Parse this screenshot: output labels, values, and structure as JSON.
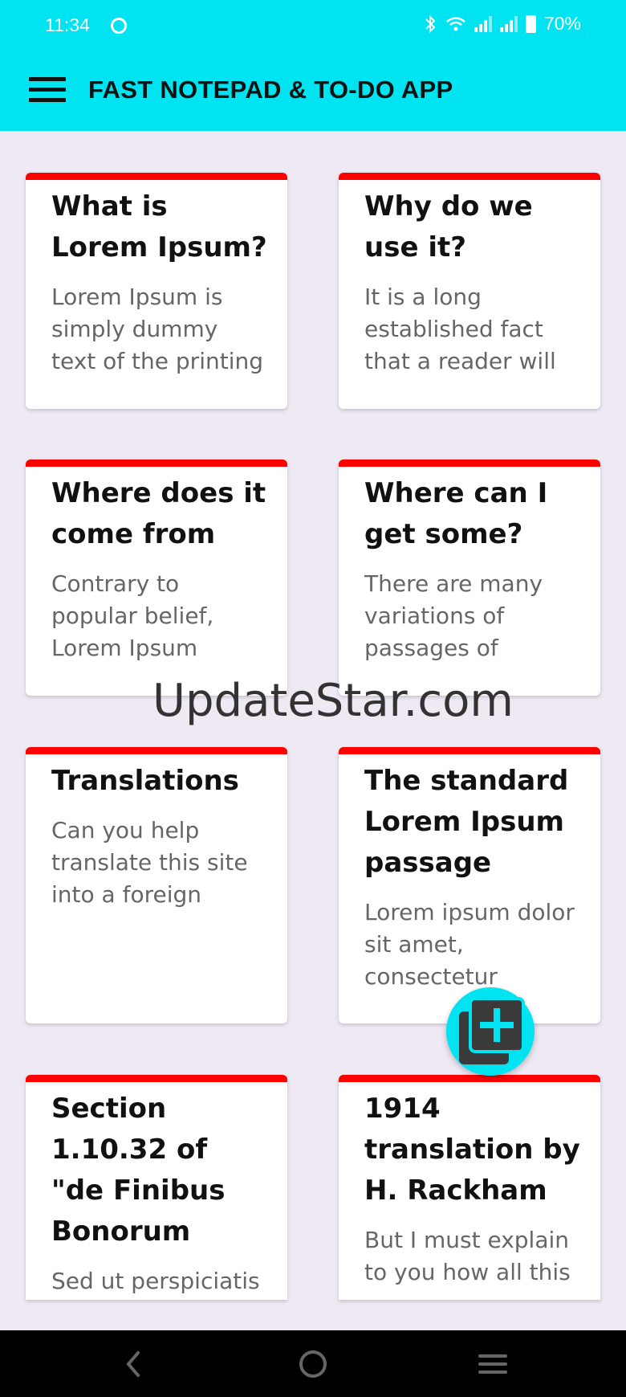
{
  "status_bar": {
    "time": "11:34",
    "battery": "70%"
  },
  "app_bar": {
    "title": "FAST NOTEPAD & TO-DO APP",
    "background_color": "#00e3f0"
  },
  "accent_color": "#ff0000",
  "notes": [
    {
      "title": "What is Lorem Ipsum?",
      "preview": "Lorem Ipsum is simply dummy text of the printing"
    },
    {
      "title": "Why do we use it?",
      "preview": "It is a long established fact that a reader will"
    },
    {
      "title": "Where does it come from",
      "preview": "Contrary to popular belief, Lorem Ipsum"
    },
    {
      "title": "Where can I get some?",
      "preview": "There are many variations of passages of"
    },
    {
      "title": "Translations",
      "preview": "Can you help translate this site into a foreign"
    },
    {
      "title": "The standard Lorem Ipsum passage",
      "preview": "Lorem ipsum dolor sit amet, consectetur"
    },
    {
      "title": "Section 1.10.32 of \"de Finibus Bonorum",
      "preview": "Sed ut perspiciatis unde omnis"
    },
    {
      "title": "1914 translation by H. Rackham",
      "preview": "But I must explain to you how all this"
    }
  ],
  "watermark": "UpdateStar.com",
  "fab": {
    "icon": "add-note-icon"
  },
  "nav_bar": {
    "icons": [
      "back-icon",
      "home-icon",
      "recents-icon"
    ]
  }
}
